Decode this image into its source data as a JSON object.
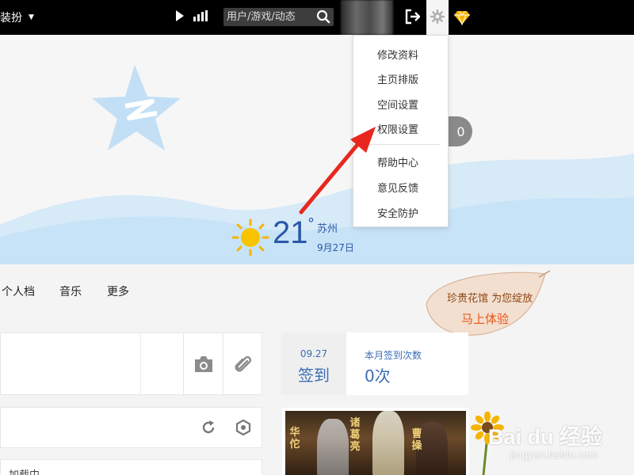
{
  "topbar": {
    "dress_label": "装扮",
    "search_placeholder": "用户/游戏/动态"
  },
  "dropdown": {
    "items": [
      "修改资料",
      "主页排版",
      "空间设置",
      "权限设置",
      "帮助中心",
      "意见反馈",
      "安全防护"
    ]
  },
  "weather": {
    "temperature": "21",
    "degree": "°",
    "city": "苏州",
    "date": "9月27日"
  },
  "badge_count": "0",
  "nav": {
    "items": [
      "个人档",
      "音乐",
      "更多"
    ]
  },
  "promo": {
    "line1": "珍贵花馆 为您绽放",
    "line2": "马上体验"
  },
  "checkin": {
    "date": "09.27",
    "sign_label": "签到",
    "month_label": "本月签到次数",
    "month_count": "0次"
  },
  "loading_text": "加载中",
  "game_banner": {
    "names": [
      "华佗",
      "诸葛亮",
      "曹操"
    ]
  },
  "watermark": {
    "brand": "Bai du 经验",
    "url": "jingyan.baidu.com"
  },
  "colors": {
    "accent_blue": "#2a58a8",
    "highlight_red": "#e8281e",
    "promo_orange": "#e8561a"
  },
  "icons": [
    "caret-down-icon",
    "play-icon",
    "bars-icon",
    "search-icon",
    "logout-icon",
    "gear-icon",
    "diamond-icon",
    "camera-icon",
    "paperclip-icon",
    "refresh-icon",
    "settings-hex-icon",
    "sun-icon"
  ]
}
